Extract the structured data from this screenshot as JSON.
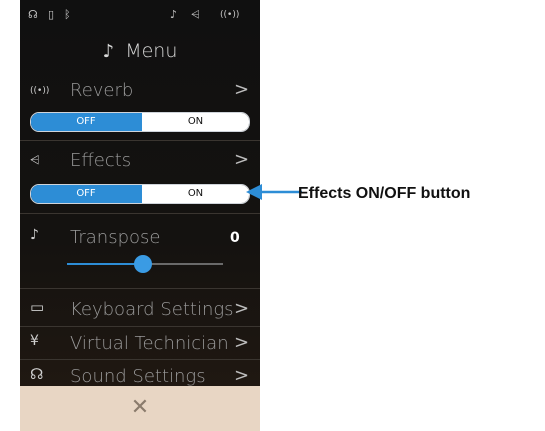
{
  "status_icons": {
    "headphones": "☊",
    "usb": "▯",
    "bluetooth": "ᛒ",
    "transpose": "♪",
    "effects": "⩤",
    "reverb": "((•))"
  },
  "menu": {
    "title": "Menu",
    "note_icon": "♪"
  },
  "reverb": {
    "icon": "((•))",
    "label": "Reverb",
    "chevron": ">",
    "off_label": "OFF",
    "on_label": "ON",
    "state": "OFF"
  },
  "effects": {
    "icon": "⩤",
    "label": "Effects",
    "chevron": ">",
    "off_label": "OFF",
    "on_label": "ON",
    "state": "OFF"
  },
  "transpose": {
    "icon": "♪",
    "label": "Transpose",
    "value": "0",
    "slider_position": 0.5
  },
  "items": [
    {
      "icon": "▭",
      "label": "Keyboard Settings",
      "chevron": ">"
    },
    {
      "icon": "¥",
      "label": "Virtual Technician",
      "chevron": ">"
    },
    {
      "icon": "☊",
      "label": "Sound Settings",
      "chevron": ">"
    }
  ],
  "close": {
    "label": "✕"
  },
  "annotation": {
    "text": "Effects ON/OFF button"
  },
  "colors": {
    "accent": "#2d8dd6",
    "toggle_on_bg": "#ffffff",
    "close_bar": "#e8d6c4"
  }
}
